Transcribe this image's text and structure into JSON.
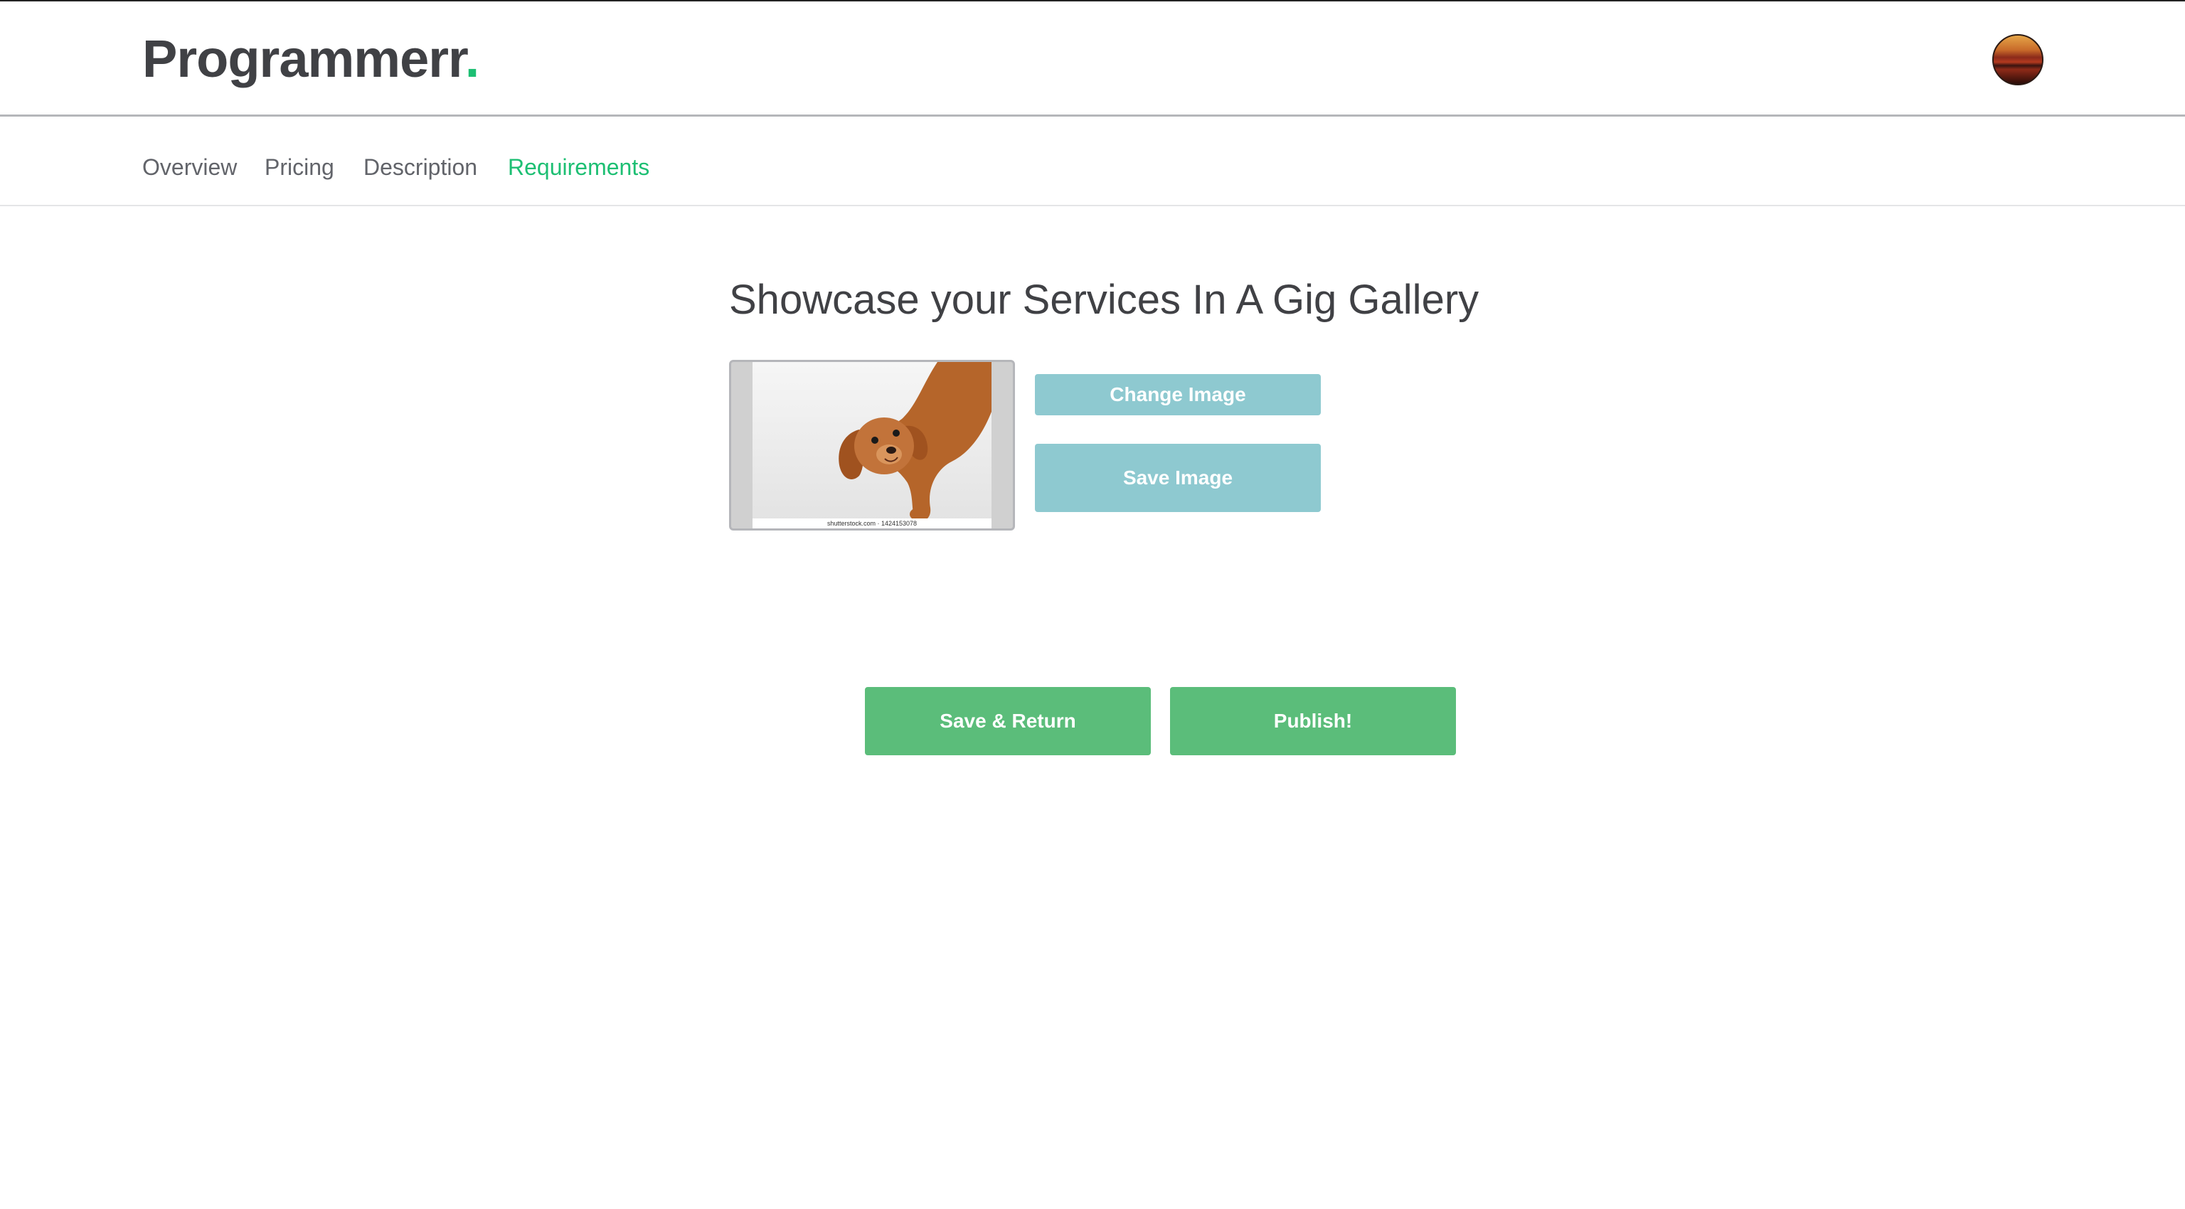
{
  "header": {
    "logo_text": "Programmerr",
    "logo_dot": ".",
    "avatar_icon": "user-avatar"
  },
  "tabs": [
    {
      "label": "Overview",
      "active": false
    },
    {
      "label": "Pricing",
      "active": false
    },
    {
      "label": "Description",
      "active": false
    },
    {
      "label": "Requirements",
      "active": true
    }
  ],
  "main": {
    "title": "Showcase your Services In A Gig Gallery",
    "gallery": {
      "caption": "shutterstock.com · 1424153078"
    },
    "buttons": {
      "change_image": "Change Image",
      "save_image": "Save Image",
      "save_return": "Save & Return",
      "publish": "Publish!"
    }
  },
  "colors": {
    "accent": "#1dbf73",
    "teal_button": "#8ec9d0",
    "green_button": "#5bbd7a",
    "text": "#404145"
  }
}
